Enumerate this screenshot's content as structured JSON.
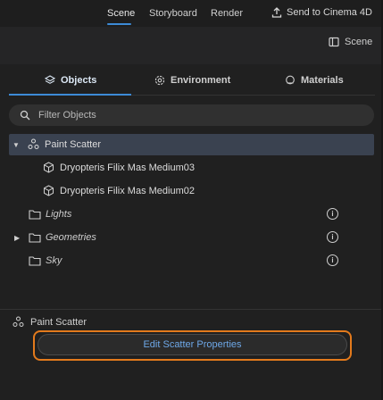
{
  "top_tabs": [
    {
      "label": "Scene",
      "active": true
    },
    {
      "label": "Storyboard",
      "active": false
    },
    {
      "label": "Render",
      "active": false
    }
  ],
  "send_label": "Send to Cinema 4D",
  "scene_toggle_label": "Scene",
  "panel_tabs": [
    {
      "label": "Objects",
      "active": true,
      "icon": "layers-icon"
    },
    {
      "label": "Environment",
      "active": false,
      "icon": "environment-icon"
    },
    {
      "label": "Materials",
      "active": false,
      "icon": "material-icon"
    }
  ],
  "filter": {
    "placeholder": "Filter Objects",
    "value": ""
  },
  "tree": [
    {
      "label": "Paint Scatter",
      "icon": "scatter-icon",
      "expanded": true,
      "selected": true
    },
    {
      "label": "Dryopteris Filix Mas Medium03",
      "icon": "cube-icon"
    },
    {
      "label": "Dryopteris Filix Mas Medium02",
      "icon": "cube-icon"
    },
    {
      "label": "Lights",
      "icon": "folder-icon",
      "info": true
    },
    {
      "label": "Geometries",
      "icon": "folder-icon",
      "info": true,
      "collapsed": true
    },
    {
      "label": "Sky",
      "icon": "folder-icon",
      "info": true
    }
  ],
  "properties": {
    "section_label": "Paint Scatter",
    "edit_button_label": "Edit Scatter Properties",
    "highlight_color": "#e37a1c"
  },
  "colors": {
    "accent": "#3d8bd6",
    "selection": "#3a4250",
    "button_text": "#6ea8e8"
  }
}
